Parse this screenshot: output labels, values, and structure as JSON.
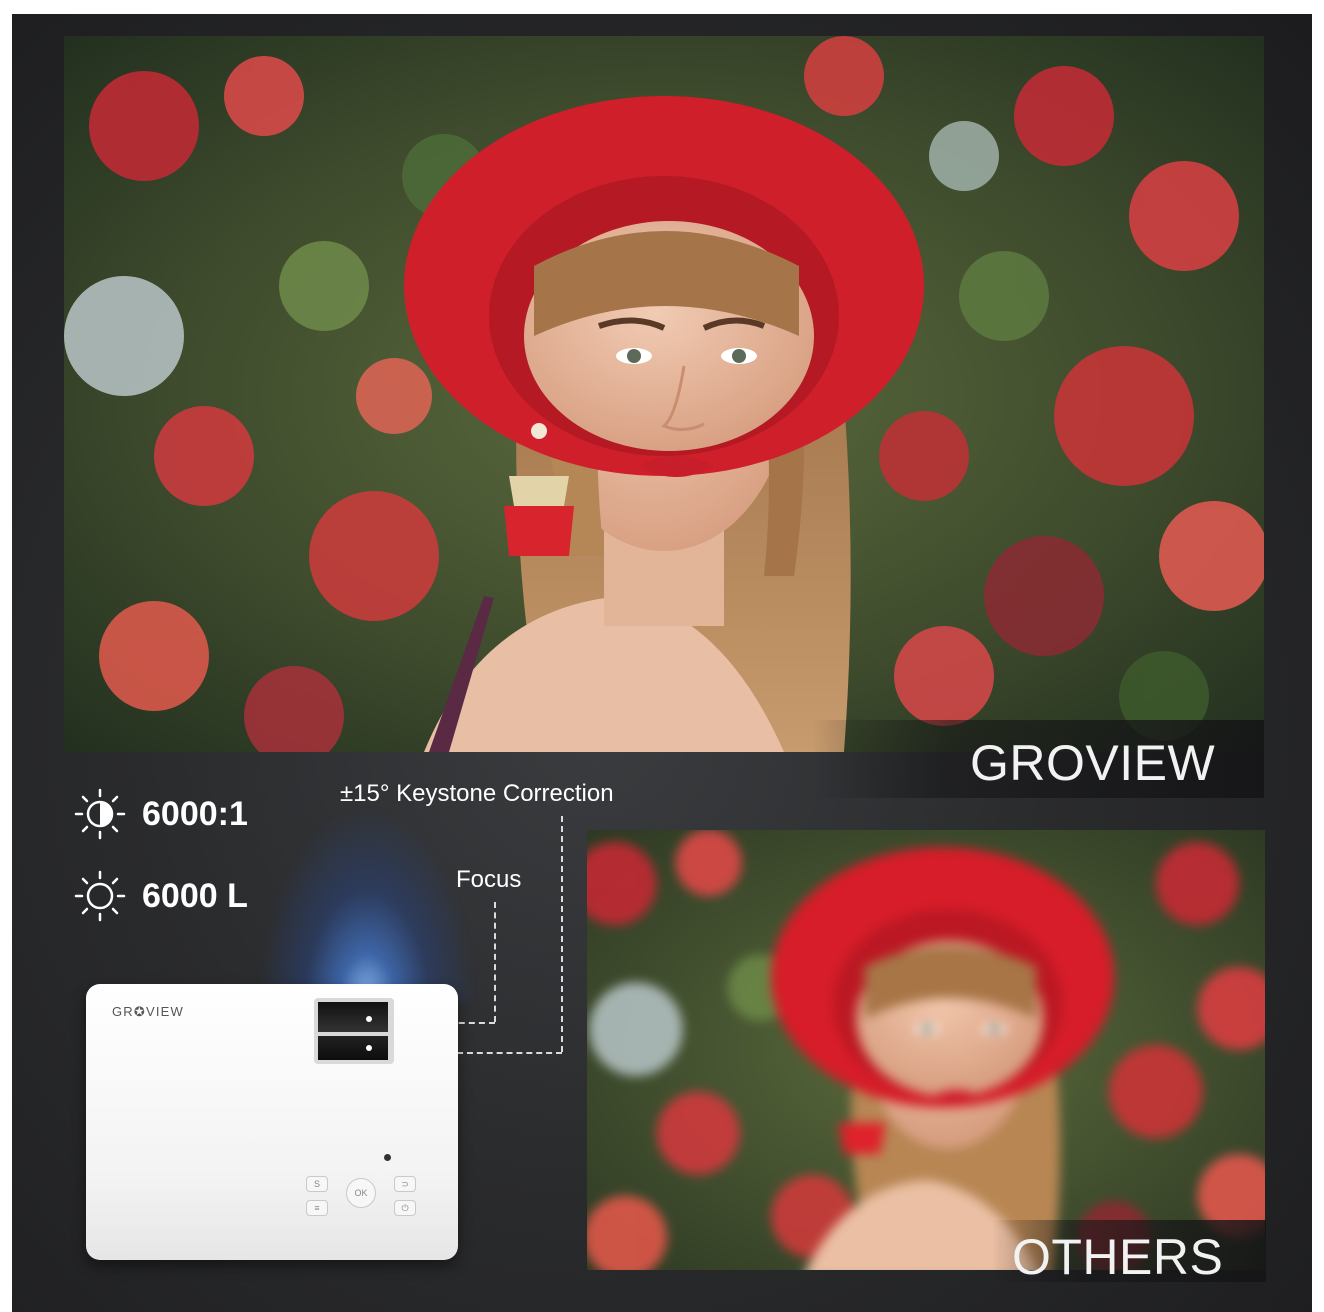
{
  "specs": [
    {
      "icon": "contrast-icon",
      "value": "6000:1"
    },
    {
      "icon": "brightness-icon",
      "value": "6000 L"
    }
  ],
  "annotations": {
    "keystone": "±15° Keystone Correction",
    "focus": "Focus"
  },
  "comparison": {
    "top_label": "GROVIEW",
    "bottom_label": "OTHERS"
  },
  "projector": {
    "brand": "GR✪VIEW",
    "keys": [
      "S",
      "OK",
      "≡",
      "⏻",
      "⊃"
    ]
  },
  "colors": {
    "background": "#2a2b2d",
    "hat": "#d41f2a",
    "accent_beam": "#6fa8ff"
  }
}
